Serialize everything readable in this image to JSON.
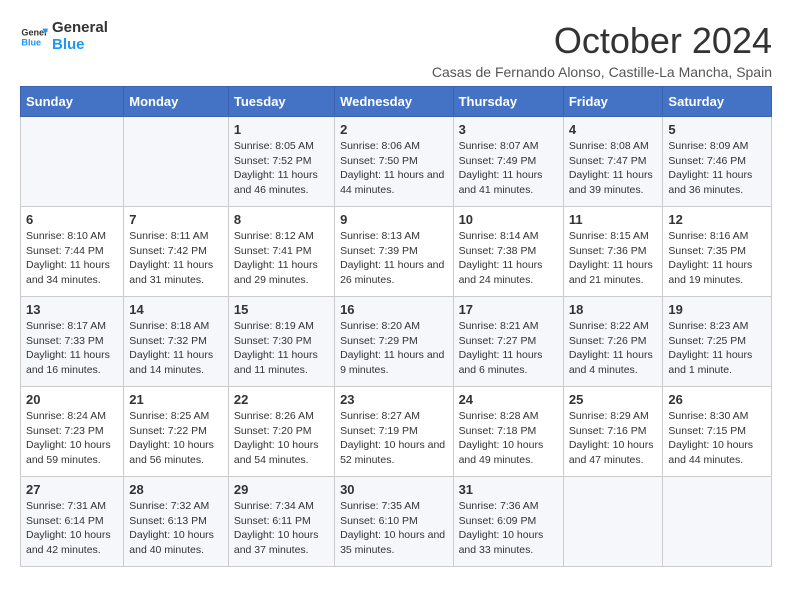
{
  "logo": {
    "line1": "General",
    "line2": "Blue"
  },
  "title": "October 2024",
  "subtitle": "Casas de Fernando Alonso, Castille-La Mancha, Spain",
  "days_header": [
    "Sunday",
    "Monday",
    "Tuesday",
    "Wednesday",
    "Thursday",
    "Friday",
    "Saturday"
  ],
  "weeks": [
    [
      {
        "day": "",
        "info": ""
      },
      {
        "day": "",
        "info": ""
      },
      {
        "day": "1",
        "info": "Sunrise: 8:05 AM\nSunset: 7:52 PM\nDaylight: 11 hours and 46 minutes."
      },
      {
        "day": "2",
        "info": "Sunrise: 8:06 AM\nSunset: 7:50 PM\nDaylight: 11 hours and 44 minutes."
      },
      {
        "day": "3",
        "info": "Sunrise: 8:07 AM\nSunset: 7:49 PM\nDaylight: 11 hours and 41 minutes."
      },
      {
        "day": "4",
        "info": "Sunrise: 8:08 AM\nSunset: 7:47 PM\nDaylight: 11 hours and 39 minutes."
      },
      {
        "day": "5",
        "info": "Sunrise: 8:09 AM\nSunset: 7:46 PM\nDaylight: 11 hours and 36 minutes."
      }
    ],
    [
      {
        "day": "6",
        "info": "Sunrise: 8:10 AM\nSunset: 7:44 PM\nDaylight: 11 hours and 34 minutes."
      },
      {
        "day": "7",
        "info": "Sunrise: 8:11 AM\nSunset: 7:42 PM\nDaylight: 11 hours and 31 minutes."
      },
      {
        "day": "8",
        "info": "Sunrise: 8:12 AM\nSunset: 7:41 PM\nDaylight: 11 hours and 29 minutes."
      },
      {
        "day": "9",
        "info": "Sunrise: 8:13 AM\nSunset: 7:39 PM\nDaylight: 11 hours and 26 minutes."
      },
      {
        "day": "10",
        "info": "Sunrise: 8:14 AM\nSunset: 7:38 PM\nDaylight: 11 hours and 24 minutes."
      },
      {
        "day": "11",
        "info": "Sunrise: 8:15 AM\nSunset: 7:36 PM\nDaylight: 11 hours and 21 minutes."
      },
      {
        "day": "12",
        "info": "Sunrise: 8:16 AM\nSunset: 7:35 PM\nDaylight: 11 hours and 19 minutes."
      }
    ],
    [
      {
        "day": "13",
        "info": "Sunrise: 8:17 AM\nSunset: 7:33 PM\nDaylight: 11 hours and 16 minutes."
      },
      {
        "day": "14",
        "info": "Sunrise: 8:18 AM\nSunset: 7:32 PM\nDaylight: 11 hours and 14 minutes."
      },
      {
        "day": "15",
        "info": "Sunrise: 8:19 AM\nSunset: 7:30 PM\nDaylight: 11 hours and 11 minutes."
      },
      {
        "day": "16",
        "info": "Sunrise: 8:20 AM\nSunset: 7:29 PM\nDaylight: 11 hours and 9 minutes."
      },
      {
        "day": "17",
        "info": "Sunrise: 8:21 AM\nSunset: 7:27 PM\nDaylight: 11 hours and 6 minutes."
      },
      {
        "day": "18",
        "info": "Sunrise: 8:22 AM\nSunset: 7:26 PM\nDaylight: 11 hours and 4 minutes."
      },
      {
        "day": "19",
        "info": "Sunrise: 8:23 AM\nSunset: 7:25 PM\nDaylight: 11 hours and 1 minute."
      }
    ],
    [
      {
        "day": "20",
        "info": "Sunrise: 8:24 AM\nSunset: 7:23 PM\nDaylight: 10 hours and 59 minutes."
      },
      {
        "day": "21",
        "info": "Sunrise: 8:25 AM\nSunset: 7:22 PM\nDaylight: 10 hours and 56 minutes."
      },
      {
        "day": "22",
        "info": "Sunrise: 8:26 AM\nSunset: 7:20 PM\nDaylight: 10 hours and 54 minutes."
      },
      {
        "day": "23",
        "info": "Sunrise: 8:27 AM\nSunset: 7:19 PM\nDaylight: 10 hours and 52 minutes."
      },
      {
        "day": "24",
        "info": "Sunrise: 8:28 AM\nSunset: 7:18 PM\nDaylight: 10 hours and 49 minutes."
      },
      {
        "day": "25",
        "info": "Sunrise: 8:29 AM\nSunset: 7:16 PM\nDaylight: 10 hours and 47 minutes."
      },
      {
        "day": "26",
        "info": "Sunrise: 8:30 AM\nSunset: 7:15 PM\nDaylight: 10 hours and 44 minutes."
      }
    ],
    [
      {
        "day": "27",
        "info": "Sunrise: 7:31 AM\nSunset: 6:14 PM\nDaylight: 10 hours and 42 minutes."
      },
      {
        "day": "28",
        "info": "Sunrise: 7:32 AM\nSunset: 6:13 PM\nDaylight: 10 hours and 40 minutes."
      },
      {
        "day": "29",
        "info": "Sunrise: 7:34 AM\nSunset: 6:11 PM\nDaylight: 10 hours and 37 minutes."
      },
      {
        "day": "30",
        "info": "Sunrise: 7:35 AM\nSunset: 6:10 PM\nDaylight: 10 hours and 35 minutes."
      },
      {
        "day": "31",
        "info": "Sunrise: 7:36 AM\nSunset: 6:09 PM\nDaylight: 10 hours and 33 minutes."
      },
      {
        "day": "",
        "info": ""
      },
      {
        "day": "",
        "info": ""
      }
    ]
  ]
}
